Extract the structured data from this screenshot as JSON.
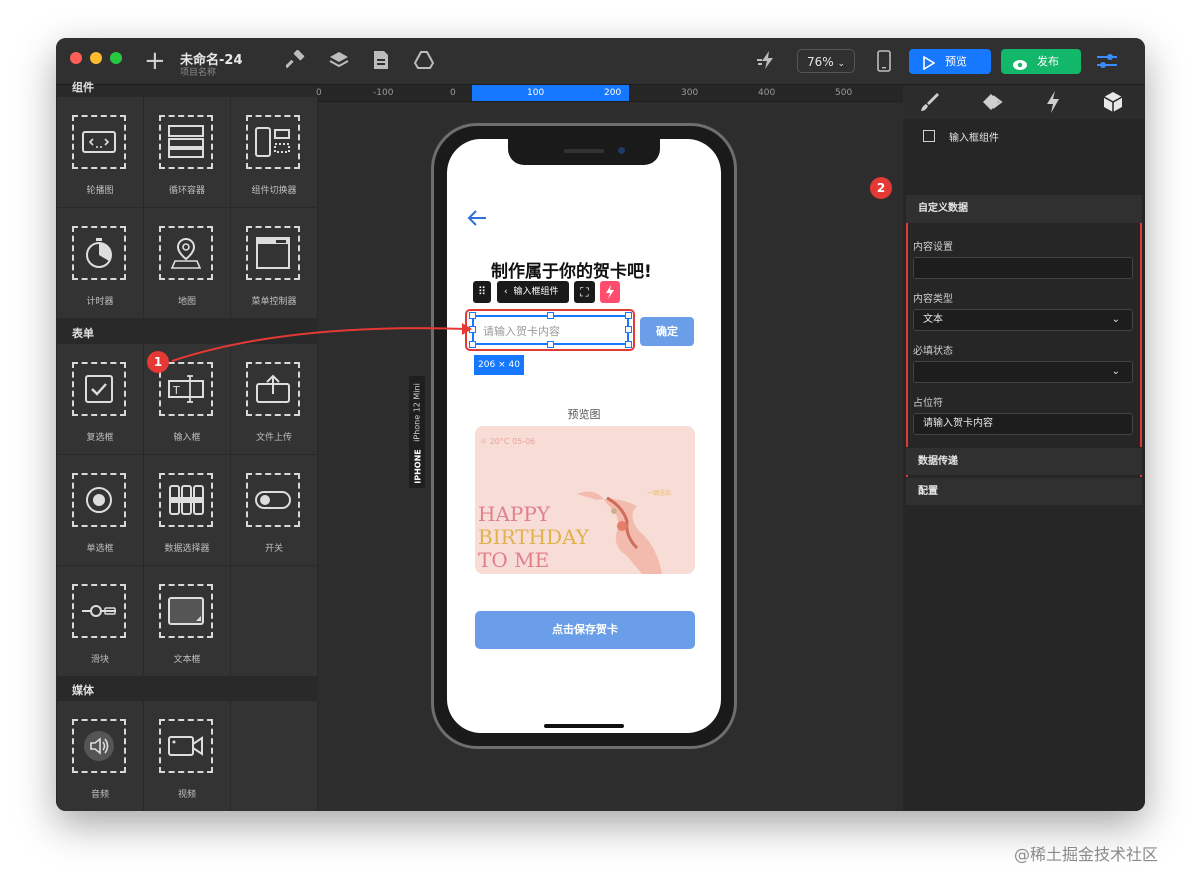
{
  "titlebar": {
    "title": "未命名-24",
    "subtitle": "项目名称",
    "zoom": "76%",
    "preview_label": "预览",
    "publish_label": "发布"
  },
  "left_panel": {
    "top_section": "组件",
    "top_items": [
      "轮播图",
      "循环容器",
      "组件切换器",
      "计时器",
      "地图",
      "菜单控制器"
    ],
    "form_section": "表单",
    "form_items": [
      "复选框",
      "输入框",
      "文件上传",
      "单选框",
      "数据选择器",
      "开关",
      "滑块",
      "文本框"
    ],
    "media_section": "媒体",
    "media_items": [
      "音频",
      "视频"
    ]
  },
  "ruler": {
    "ticks": [
      "0",
      "-100",
      "0",
      "100",
      "200",
      "300",
      "400",
      "500"
    ]
  },
  "phone": {
    "device_label": "iPhone 12 Mini",
    "device_type": "IPHONE",
    "heading": "制作属于你的贺卡吧!",
    "component_tag": "输入框组件",
    "input_placeholder": "请输入贺卡内容",
    "confirm_label": "确定",
    "size_badge": "206 × 40",
    "preview_label": "预览图",
    "card_weather": "20°C 05-06",
    "card_small": "一键送出",
    "card_line1": "HAPPY",
    "card_line2": "BIRTHDAY",
    "card_line3": "TO ME",
    "save_label": "点击保存贺卡"
  },
  "right_panel": {
    "component_name": "输入框组件",
    "section_custom": "自定义数据",
    "content_setting_label": "内容设置",
    "content_setting_value": "",
    "content_type_label": "内容类型",
    "content_type_value": "文本",
    "required_label": "必填状态",
    "required_value": "",
    "placeholder_label": "占位符",
    "placeholder_value": "请输入贺卡内容",
    "section_data": "数据传递",
    "section_config": "配置"
  },
  "annotations": {
    "a1": "1",
    "a2": "2"
  },
  "watermark": "@稀土掘金技术社区",
  "colors": {
    "accent_blue": "#1677ff",
    "publish_green": "#12b76a",
    "annotation_red": "#e53935",
    "button_blue": "#6a9ee8"
  }
}
